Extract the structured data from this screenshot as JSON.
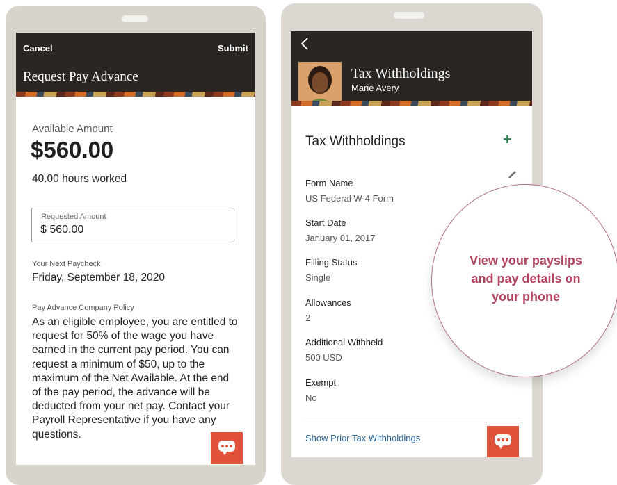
{
  "left_phone": {
    "header": {
      "cancel": "Cancel",
      "submit": "Submit",
      "title": "Request Pay Advance"
    },
    "available_label": "Available Amount",
    "available_amount": "$560.00",
    "hours_worked": "40.00 hours worked",
    "requested_amount": {
      "label": "Requested Amount",
      "value": "$ 560.00"
    },
    "next_paycheck": {
      "label": "Your Next Paycheck",
      "value": "Friday, September 18, 2020"
    },
    "policy": {
      "label": "Pay Advance Company Policy",
      "text": "As an eligible employee, you are entitled to request for 50% of the wage you have earned in the current pay period. You can request a minimum of $50, up to the maximum of the Net Available. At the end of the pay period, the advance will be deducted from your net pay. Contact your Payroll Representative if you have any questions."
    },
    "chat_icon": "chat-bubble-icon"
  },
  "right_phone": {
    "header": {
      "back_icon": "chevron-left-icon",
      "title": "Tax Withholdings",
      "subtitle": "Marie Avery"
    },
    "section_title": "Tax Withholdings",
    "add_icon": "plus-icon",
    "edit_icon": "pencil-icon",
    "fields": [
      {
        "label": "Form Name",
        "value": "US Federal W-4 Form"
      },
      {
        "label": "Start Date",
        "value": "January 01, 2017"
      },
      {
        "label": "Filling Status",
        "value": "Single"
      },
      {
        "label": "Allowances",
        "value": "2"
      },
      {
        "label": "Additional Withheld",
        "value": "500 USD"
      },
      {
        "label": "Exempt",
        "value": "No"
      }
    ],
    "show_prior_link": "Show Prior Tax Withholdings",
    "chat_icon": "chat-bubble-icon"
  },
  "callout": {
    "line1": "View your payslips",
    "line2": "and pay details on",
    "line3": "your phone"
  },
  "colors": {
    "header": "#2a2623",
    "accent_orange": "#e0533a",
    "link_blue": "#2a6496",
    "add_green": "#2e7d4f",
    "callout_text": "#b2445f"
  }
}
